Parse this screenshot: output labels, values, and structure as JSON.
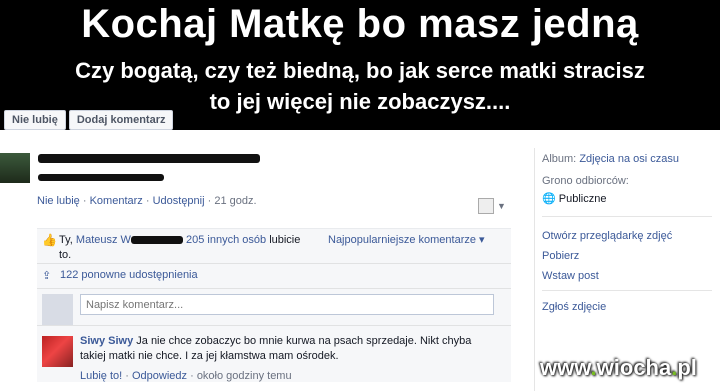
{
  "photo": {
    "line1": "Kochaj Matkę bo masz jedną",
    "line2": "Czy bogatą, czy też biedną, bo jak serce matki stracisz",
    "line3": "to jej więcej nie zobaczysz....",
    "unlike_label": "Nie lubię",
    "add_comment_label": "Dodaj komentarz"
  },
  "post": {
    "unlike": "Nie lubię",
    "comment": "Komentarz",
    "share": "Udostępnij",
    "time": "21 godz."
  },
  "likes": {
    "prefix": "Ty,",
    "name": "Mateusz W",
    "others": "205 innych osób",
    "suffix": "lubicie",
    "suffix2": "to.",
    "sort": "Najpopularniejsze komentarze"
  },
  "shares": {
    "text": "122 ponowne udostępnienia"
  },
  "compose": {
    "placeholder": "Napisz komentarz..."
  },
  "comment": {
    "author": "Siwy Siwy",
    "text": "Ja nie chce zobaczyc bo mnie kurwa na psach sprzedaje. Nikt chyba takiej matki nie chce. I za jej kłamstwa mam ośrodek.",
    "like": "Lubię to!",
    "reply": "Odpowiedz",
    "time": "około godziny temu"
  },
  "sidebar": {
    "album_label": "Album:",
    "album_value": "Zdjęcia na osi czasu",
    "audience_label": "Grono odbiorców:",
    "audience_value": "Publiczne",
    "open_viewer": "Otwórz przeglądarkę zdjęć",
    "download": "Pobierz",
    "embed": "Wstaw post",
    "report": "Zgłoś zdjęcie"
  },
  "watermark": {
    "prefix": "www",
    "name": "wiocha",
    "suffix": "pl"
  }
}
